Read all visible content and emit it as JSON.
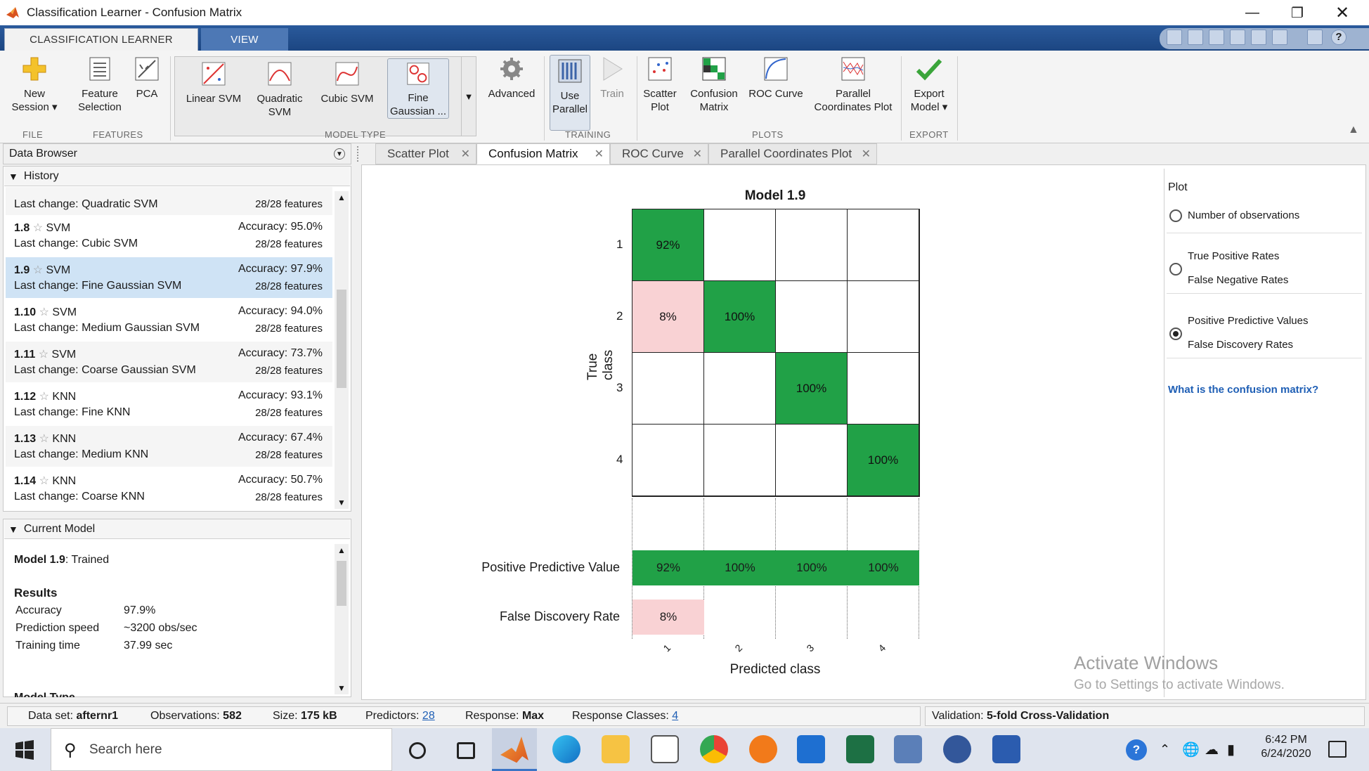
{
  "window": {
    "title": "Classification Learner - Confusion Matrix"
  },
  "ribbon_tabs": [
    "CLASSIFICATION LEARNER",
    "VIEW"
  ],
  "ribbon": {
    "new_session": [
      "New",
      "Session"
    ],
    "feature_selection": [
      "Feature",
      "Selection"
    ],
    "pca": "PCA",
    "linear_svm": "Linear SVM",
    "quadratic_svm": [
      "Quadratic",
      "SVM"
    ],
    "cubic_svm": "Cubic SVM",
    "fine_gaussian": [
      "Fine",
      "Gaussian ..."
    ],
    "advanced": "Advanced",
    "use_parallel": [
      "Use",
      "Parallel"
    ],
    "train": "Train",
    "scatter_plot": [
      "Scatter",
      "Plot"
    ],
    "confusion_matrix": [
      "Confusion",
      "Matrix"
    ],
    "roc_curve": "ROC Curve",
    "parallel_coords": [
      "Parallel",
      "Coordinates Plot"
    ],
    "export_model": [
      "Export",
      "Model"
    ],
    "groups": {
      "file": "FILE",
      "features": "FEATURES",
      "model_type": "MODEL TYPE",
      "training": "TRAINING",
      "plots": "PLOTS",
      "export": "EXPORT"
    }
  },
  "data_browser": {
    "title": "Data Browser",
    "history_label": "History",
    "top_partial": {
      "change": "Last change:  Quadratic SVM",
      "features": "28/28 features"
    },
    "items": [
      {
        "id": "1.8",
        "type": "SVM",
        "accuracy": "Accuracy:  95.0%",
        "change": "Last change:  Cubic SVM",
        "features": "28/28 features"
      },
      {
        "id": "1.9",
        "type": "SVM",
        "accuracy": "Accuracy:  97.9%",
        "change": "Last change:  Fine Gaussian SVM",
        "features": "28/28 features"
      },
      {
        "id": "1.10",
        "type": "SVM",
        "accuracy": "Accuracy:  94.0%",
        "change": "Last change:  Medium Gaussian SVM",
        "features": "28/28 features"
      },
      {
        "id": "1.11",
        "type": "SVM",
        "accuracy": "Accuracy:  73.7%",
        "change": "Last change:  Coarse Gaussian SVM",
        "features": "28/28 features"
      },
      {
        "id": "1.12",
        "type": "KNN",
        "accuracy": "Accuracy:  93.1%",
        "change": "Last change:  Fine KNN",
        "features": "28/28 features"
      },
      {
        "id": "1.13",
        "type": "KNN",
        "accuracy": "Accuracy:  67.4%",
        "change": "Last change:  Medium KNN",
        "features": "28/28 features"
      },
      {
        "id": "1.14",
        "type": "KNN",
        "accuracy": "Accuracy:  50.7%",
        "change": "Last change:  Coarse KNN",
        "features": "28/28 features"
      }
    ]
  },
  "current_model": {
    "label": "Current Model",
    "model_name": "Model 1.9",
    "status": ": Trained",
    "results_label": "Results",
    "accuracy_label": "Accuracy",
    "accuracy": "97.9%",
    "speed_label": "Prediction speed",
    "speed": "~3200 obs/sec",
    "time_label": "Training time",
    "time": "37.99 sec",
    "partial": "Model Type"
  },
  "doc_tabs": [
    "Scatter Plot",
    "Confusion Matrix",
    "ROC Curve",
    "Parallel Coordinates Plot"
  ],
  "chart_data": {
    "type": "heatmap",
    "title": "Model 1.9",
    "xlabel": "Predicted class",
    "ylabel": "True class",
    "true_classes": [
      "1",
      "2",
      "3",
      "4"
    ],
    "predicted_classes": [
      "1",
      "2",
      "3",
      "4"
    ],
    "cells": [
      [
        "92%",
        "",
        "",
        ""
      ],
      [
        "8%",
        "100%",
        "",
        ""
      ],
      [
        "",
        "",
        "100%",
        ""
      ],
      [
        "",
        "",
        "",
        "100%"
      ]
    ],
    "summary_rows": [
      {
        "name": "Positive Predictive Value",
        "values": [
          "92%",
          "100%",
          "100%",
          "100%"
        ]
      },
      {
        "name": "False Discovery Rate",
        "values": [
          "8%",
          "",
          "",
          ""
        ]
      }
    ],
    "colors": {
      "correct": "#21a147",
      "error": "#f9d2d4"
    }
  },
  "plot_options": {
    "title": "Plot",
    "opt1": "Number of observations",
    "opt2a": "True Positive Rates",
    "opt2b": "False Negative Rates",
    "opt3a": "Positive Predictive Values",
    "opt3b": "False Discovery Rates",
    "selected": 3,
    "link": "What is the confusion matrix?"
  },
  "watermark": {
    "line1": "Activate Windows",
    "line2": "Go to Settings to activate Windows."
  },
  "status": {
    "dataset_label": "Data set:",
    "dataset": "afternr1",
    "obs_label": "Observations:",
    "obs": "582",
    "size_label": "Size:",
    "size": "175 kB",
    "pred_label": "Predictors:",
    "pred": "28",
    "resp_label": "Response:",
    "resp": "Max",
    "classes_label": "Response Classes:",
    "classes": "4",
    "valid_label": "Validation:",
    "valid": "5-fold Cross-Validation"
  },
  "taskbar": {
    "search": "Search here",
    "time": "6:42 PM",
    "date": "6/24/2020"
  }
}
